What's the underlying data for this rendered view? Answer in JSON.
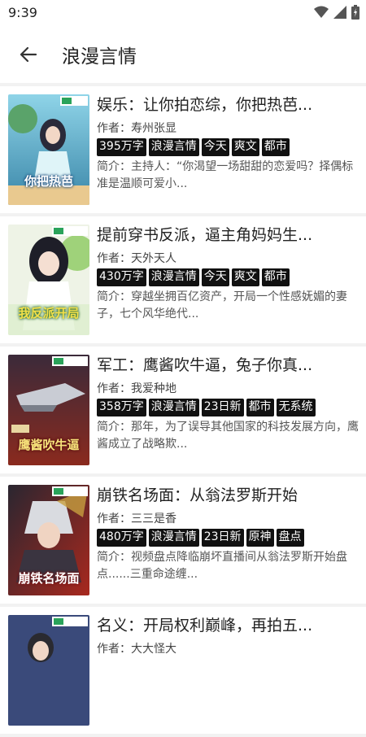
{
  "status": {
    "time": "9:39"
  },
  "header": {
    "title": "浪漫言情"
  },
  "books": [
    {
      "title": "娱乐：让你拍恋综，你把热芭...",
      "author": "作者：寿州张显",
      "tags": [
        "395万字",
        "浪漫言情",
        "今天",
        "爽文",
        "都市"
      ],
      "intro": "简介：主持人：“你渴望一场甜甜的恋爱吗？择偶标准是温顺可爱小...",
      "cover_text": "你把热芭"
    },
    {
      "title": "提前穿书反派，逼主角妈妈生...",
      "author": "作者：天外天人",
      "tags": [
        "430万字",
        "浪漫言情",
        "今天",
        "爽文",
        "都市"
      ],
      "intro": "简介：穿越坐拥百亿资产，开局一个性感妩媚的妻子，七个风华绝代...",
      "cover_text": "我反派开局"
    },
    {
      "title": "军工：鹰酱吹牛逼，兔子你真...",
      "author": "作者：我爱种地",
      "tags": [
        "358万字",
        "浪漫言情",
        "23日新",
        "都市",
        "无系统"
      ],
      "intro": "简介：那年，为了误导其他国家的科技发展方向，鹰酱成立了战略欺...",
      "cover_text": "鹰酱吹牛逼"
    },
    {
      "title": "崩铁名场面：从翁法罗斯开始",
      "author": "作者：三三是香",
      "tags": [
        "480万字",
        "浪漫言情",
        "23日新",
        "原神",
        "盘点"
      ],
      "intro": "简介：视频盘点降临崩坏直播间从翁法罗斯开始盘点......三重命途缠...",
      "cover_text": "崩铁名场面"
    },
    {
      "title": "名义：开局权利巅峰，再拍五...",
      "author": "作者：大大怪大",
      "tags": [],
      "intro": "",
      "cover_text": ""
    }
  ]
}
